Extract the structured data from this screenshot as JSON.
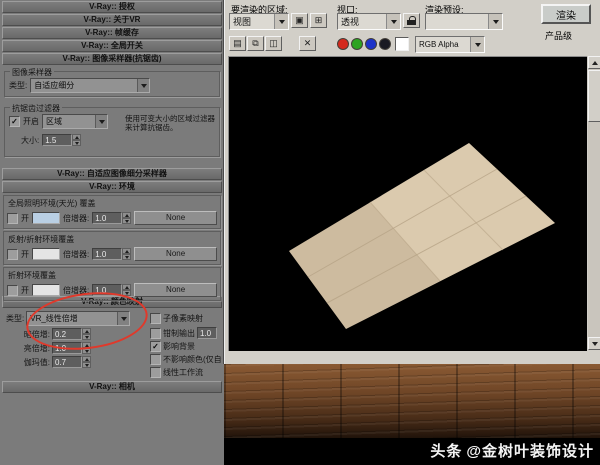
{
  "left_panel": {
    "rollouts": {
      "license": "V-Ray:: 授权",
      "about": "V-Ray:: 关于VR",
      "frame_buffer": "V-Ray:: 帧缓存",
      "global_switches": "V-Ray:: 全局开关",
      "image_sampler": "V-Ray:: 图像采样器(抗锯齿)",
      "adaptive_subdivision": "V-Ray:: 自适应图像细分采样器",
      "environment": "V-Ray:: 环境",
      "color_mapping": "V-Ray:: 颜色映射",
      "camera": "V-Ray:: 相机"
    },
    "image_sampler": {
      "group_sampler": "图像采样器",
      "type_label": "类型:",
      "type_value": "自适应细分",
      "group_filter": "抗锯齿过滤器",
      "on_label": "开启",
      "on_check": "✓",
      "filter_value": "区域",
      "size_label": "大小:",
      "size_value": "1.5",
      "hint": "使用可变大小的区域过滤器来计算抗锯齿。"
    },
    "environment": {
      "sections": [
        {
          "title": "全局照明环境(天光) 覆盖",
          "on_label": "开",
          "check": "",
          "swatch": "#b9cfe4",
          "mult_label": "倍增器:",
          "mult_value": "1.0",
          "button": "None"
        },
        {
          "title": "反射/折射环境覆盖",
          "on_label": "开",
          "check": "",
          "swatch": "#e4e4e4",
          "mult_label": "倍增器:",
          "mult_value": "1.0",
          "button": "None"
        },
        {
          "title": "折射环境覆盖",
          "on_label": "开",
          "check": "",
          "swatch": "#e4e4e4",
          "mult_label": "倍增器:",
          "mult_value": "1.0",
          "button": "None"
        }
      ]
    },
    "color_mapping": {
      "type_label": "类型:",
      "type_value": "VR_线性倍增",
      "spinners": [
        {
          "label": "暗倍增:",
          "value": "0.2"
        },
        {
          "label": "亮倍增:",
          "value": "1.0"
        },
        {
          "label": "伽玛值:",
          "value": "0.7"
        }
      ],
      "clamp_value": "1.0",
      "checks": [
        {
          "label": "子像素映射",
          "check": ""
        },
        {
          "label": "钳制输出",
          "check": ""
        },
        {
          "label": "影响背景",
          "check": "✓"
        },
        {
          "label": "不影响颜色(仅自适应)",
          "check": ""
        },
        {
          "label": "线性工作流",
          "check": ""
        }
      ]
    }
  },
  "render_window": {
    "region_label": "要渲染的区域:",
    "region_value": "视图",
    "viewport_label": "视口:",
    "viewport_value": "透视",
    "preset_label": "渲染预设:",
    "render_button": "渲染",
    "mode_value": "产品级",
    "channel_value": "RGB Alpha"
  },
  "render_canvas": {
    "plane_fill": "#d9c6a8",
    "seam": "#b7a487"
  },
  "watermark": {
    "brand": "头条",
    "handle": "@金树叶装饰设计"
  },
  "colors": {
    "annotation": "#e0392b"
  }
}
